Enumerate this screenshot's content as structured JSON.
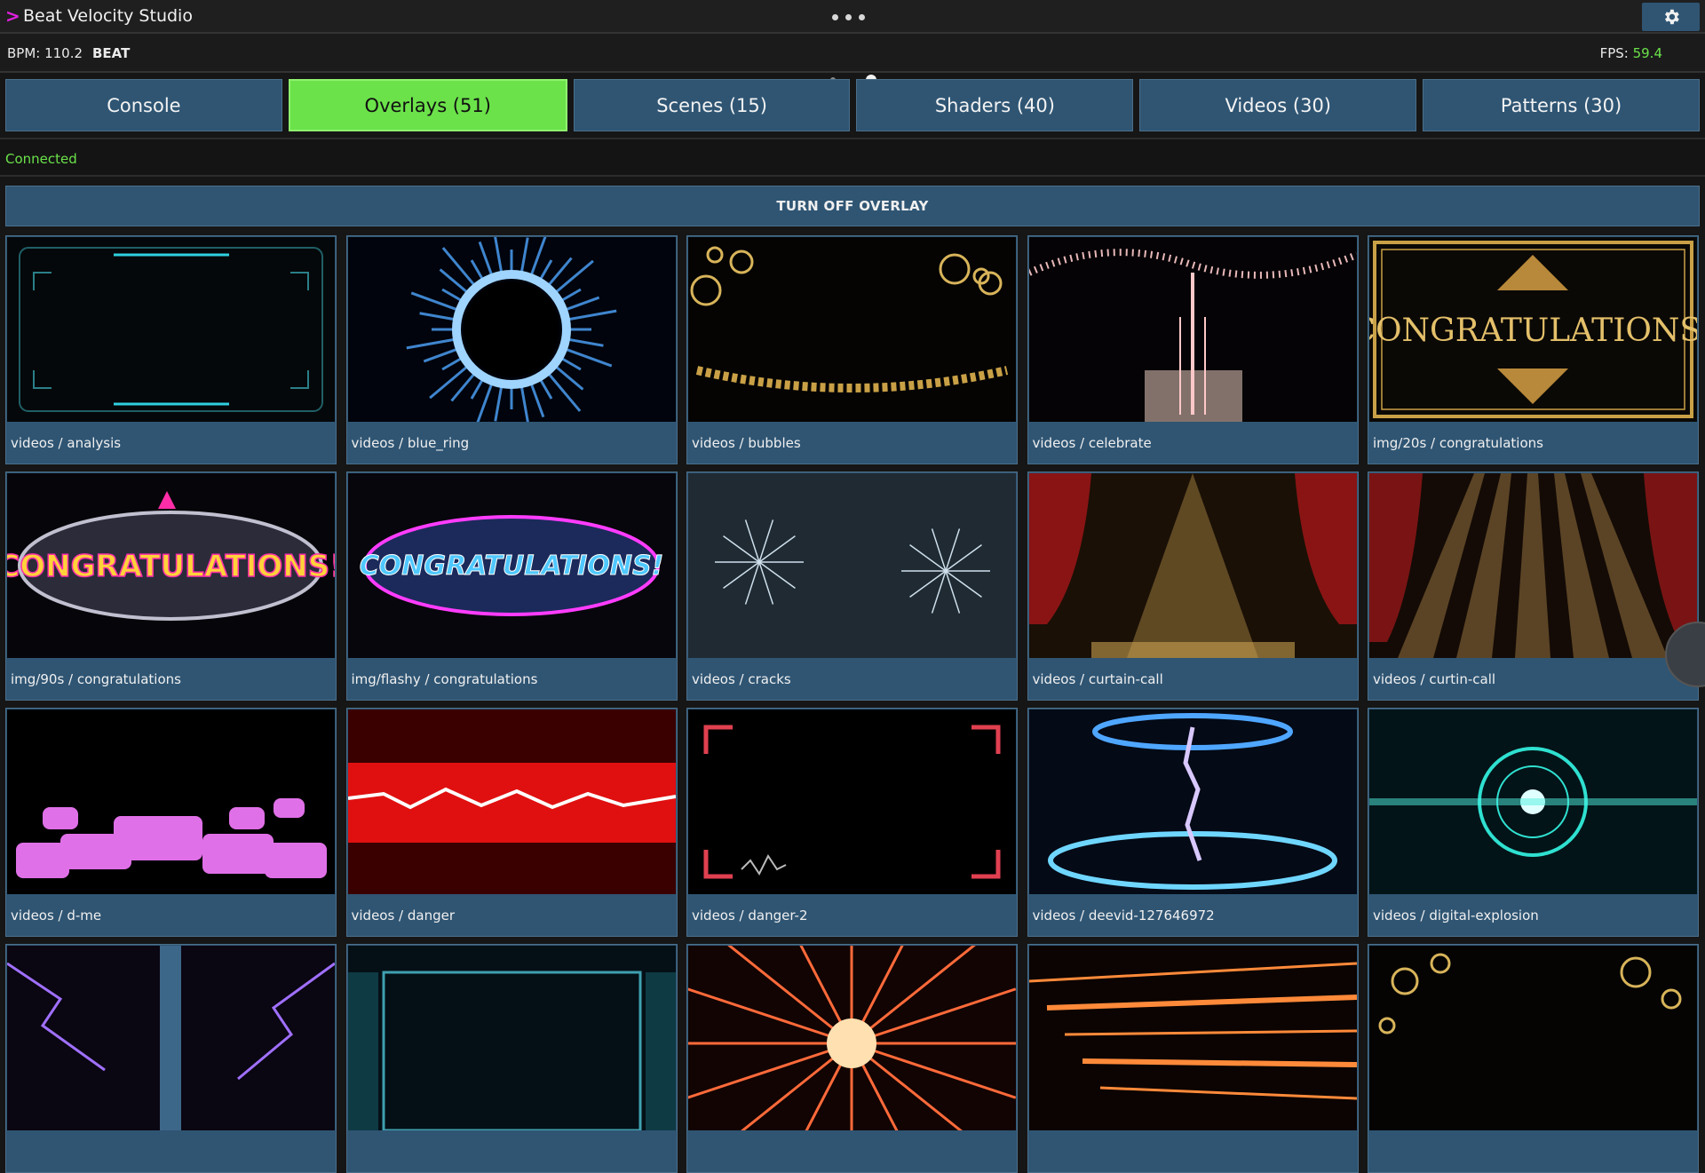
{
  "app": {
    "title": "Beat Velocity Studio",
    "prompt": ">"
  },
  "status": {
    "bpm": "BPM: 110.2",
    "beat": "BEAT",
    "fps_label": "FPS:",
    "fps_value": "59.4"
  },
  "tabs": [
    {
      "label": "Console"
    },
    {
      "label": "Overlays (51)",
      "active": true
    },
    {
      "label": "Scenes (15)"
    },
    {
      "label": "Shaders (40)"
    },
    {
      "label": "Videos (30)"
    },
    {
      "label": "Patterns (30)"
    }
  ],
  "connection": "Connected",
  "turn_off_label": "TURN OFF OVERLAY",
  "overlays": [
    {
      "label": "videos / analysis",
      "thumb": "hud-frame"
    },
    {
      "label": "videos / blue_ring",
      "thumb": "blue-ring"
    },
    {
      "label": "videos / bubbles",
      "thumb": "gold-bubbles"
    },
    {
      "label": "videos / celebrate",
      "thumb": "sparkle-wave"
    },
    {
      "label": "img/20s / congratulations",
      "thumb": "art-deco-congrats"
    },
    {
      "label": "img/90s / congratulations",
      "thumb": "90s-congrats"
    },
    {
      "label": "img/flashy / congratulations",
      "thumb": "flashy-congrats"
    },
    {
      "label": "videos / cracks",
      "thumb": "glass-cracks"
    },
    {
      "label": "videos / curtain-call",
      "thumb": "curtain-gold"
    },
    {
      "label": "videos / curtin-call",
      "thumb": "curtain-rays"
    },
    {
      "label": "videos / d-me",
      "thumb": "chat-bubbles"
    },
    {
      "label": "videos / danger",
      "thumb": "red-lightning"
    },
    {
      "label": "videos / danger-2",
      "thumb": "red-frame"
    },
    {
      "label": "videos / deevid-127646972",
      "thumb": "portal-lightning"
    },
    {
      "label": "videos / digital-explosion",
      "thumb": "digital-explosion"
    },
    {
      "label": "",
      "thumb": "purple-lightning"
    },
    {
      "label": "",
      "thumb": "fact-check-hud"
    },
    {
      "label": "",
      "thumb": "fire-burst"
    },
    {
      "label": "",
      "thumb": "orange-streaks"
    },
    {
      "label": "",
      "thumb": "gold-bubbles-2"
    }
  ],
  "colors": {
    "accent": "#6be24a",
    "tile": "#2f5573",
    "prompt": "#e020e0"
  }
}
